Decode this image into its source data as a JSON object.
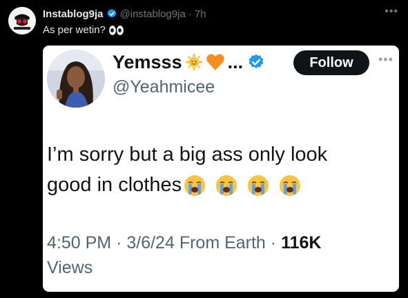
{
  "post": {
    "author_name": "Instablog9ja",
    "handle": "@instablog9ja",
    "separator": "·",
    "time": "7h",
    "text": "As per wetin?",
    "more_icon": "more-horizontal-icon"
  },
  "quoted": {
    "name": "Yemsss",
    "name_ellipsis": "...",
    "handle": "@Yeahmicee",
    "follow_label": "Follow",
    "body_line1": "I’m sorry but a big ass only look",
    "body_line2": "good in clothes",
    "meta_time": "4:50 PM",
    "meta_sep1": "·",
    "meta_date": "3/6/24",
    "meta_location": "From Earth",
    "meta_sep2": "·",
    "meta_views_count": "116K",
    "meta_views_label": "Views"
  },
  "colors": {
    "background": "#000000",
    "verified": "#1d9bf0",
    "follow_bg": "#0f1419",
    "muted": "#71767b"
  }
}
